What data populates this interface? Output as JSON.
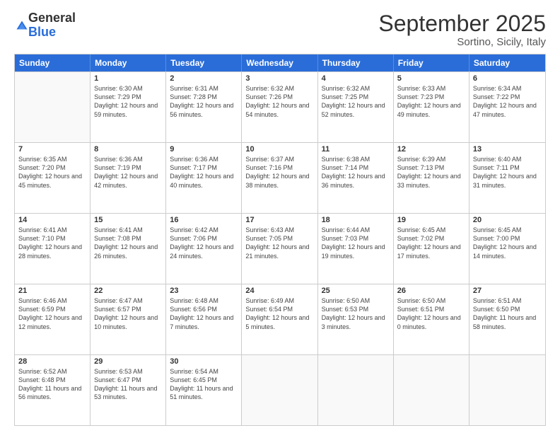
{
  "logo": {
    "general": "General",
    "blue": "Blue"
  },
  "title": "September 2025",
  "location": "Sortino, Sicily, Italy",
  "header_days": [
    "Sunday",
    "Monday",
    "Tuesday",
    "Wednesday",
    "Thursday",
    "Friday",
    "Saturday"
  ],
  "weeks": [
    [
      {
        "day": "",
        "empty": true
      },
      {
        "day": "1",
        "sunrise": "6:30 AM",
        "sunset": "7:29 PM",
        "daylight": "12 hours and 59 minutes."
      },
      {
        "day": "2",
        "sunrise": "6:31 AM",
        "sunset": "7:28 PM",
        "daylight": "12 hours and 56 minutes."
      },
      {
        "day": "3",
        "sunrise": "6:32 AM",
        "sunset": "7:26 PM",
        "daylight": "12 hours and 54 minutes."
      },
      {
        "day": "4",
        "sunrise": "6:32 AM",
        "sunset": "7:25 PM",
        "daylight": "12 hours and 52 minutes."
      },
      {
        "day": "5",
        "sunrise": "6:33 AM",
        "sunset": "7:23 PM",
        "daylight": "12 hours and 49 minutes."
      },
      {
        "day": "6",
        "sunrise": "6:34 AM",
        "sunset": "7:22 PM",
        "daylight": "12 hours and 47 minutes."
      }
    ],
    [
      {
        "day": "7",
        "sunrise": "6:35 AM",
        "sunset": "7:20 PM",
        "daylight": "12 hours and 45 minutes."
      },
      {
        "day": "8",
        "sunrise": "6:36 AM",
        "sunset": "7:19 PM",
        "daylight": "12 hours and 42 minutes."
      },
      {
        "day": "9",
        "sunrise": "6:36 AM",
        "sunset": "7:17 PM",
        "daylight": "12 hours and 40 minutes."
      },
      {
        "day": "10",
        "sunrise": "6:37 AM",
        "sunset": "7:16 PM",
        "daylight": "12 hours and 38 minutes."
      },
      {
        "day": "11",
        "sunrise": "6:38 AM",
        "sunset": "7:14 PM",
        "daylight": "12 hours and 36 minutes."
      },
      {
        "day": "12",
        "sunrise": "6:39 AM",
        "sunset": "7:13 PM",
        "daylight": "12 hours and 33 minutes."
      },
      {
        "day": "13",
        "sunrise": "6:40 AM",
        "sunset": "7:11 PM",
        "daylight": "12 hours and 31 minutes."
      }
    ],
    [
      {
        "day": "14",
        "sunrise": "6:41 AM",
        "sunset": "7:10 PM",
        "daylight": "12 hours and 28 minutes."
      },
      {
        "day": "15",
        "sunrise": "6:41 AM",
        "sunset": "7:08 PM",
        "daylight": "12 hours and 26 minutes."
      },
      {
        "day": "16",
        "sunrise": "6:42 AM",
        "sunset": "7:06 PM",
        "daylight": "12 hours and 24 minutes."
      },
      {
        "day": "17",
        "sunrise": "6:43 AM",
        "sunset": "7:05 PM",
        "daylight": "12 hours and 21 minutes."
      },
      {
        "day": "18",
        "sunrise": "6:44 AM",
        "sunset": "7:03 PM",
        "daylight": "12 hours and 19 minutes."
      },
      {
        "day": "19",
        "sunrise": "6:45 AM",
        "sunset": "7:02 PM",
        "daylight": "12 hours and 17 minutes."
      },
      {
        "day": "20",
        "sunrise": "6:45 AM",
        "sunset": "7:00 PM",
        "daylight": "12 hours and 14 minutes."
      }
    ],
    [
      {
        "day": "21",
        "sunrise": "6:46 AM",
        "sunset": "6:59 PM",
        "daylight": "12 hours and 12 minutes."
      },
      {
        "day": "22",
        "sunrise": "6:47 AM",
        "sunset": "6:57 PM",
        "daylight": "12 hours and 10 minutes."
      },
      {
        "day": "23",
        "sunrise": "6:48 AM",
        "sunset": "6:56 PM",
        "daylight": "12 hours and 7 minutes."
      },
      {
        "day": "24",
        "sunrise": "6:49 AM",
        "sunset": "6:54 PM",
        "daylight": "12 hours and 5 minutes."
      },
      {
        "day": "25",
        "sunrise": "6:50 AM",
        "sunset": "6:53 PM",
        "daylight": "12 hours and 3 minutes."
      },
      {
        "day": "26",
        "sunrise": "6:50 AM",
        "sunset": "6:51 PM",
        "daylight": "12 hours and 0 minutes."
      },
      {
        "day": "27",
        "sunrise": "6:51 AM",
        "sunset": "6:50 PM",
        "daylight": "11 hours and 58 minutes."
      }
    ],
    [
      {
        "day": "28",
        "sunrise": "6:52 AM",
        "sunset": "6:48 PM",
        "daylight": "11 hours and 56 minutes."
      },
      {
        "day": "29",
        "sunrise": "6:53 AM",
        "sunset": "6:47 PM",
        "daylight": "11 hours and 53 minutes."
      },
      {
        "day": "30",
        "sunrise": "6:54 AM",
        "sunset": "6:45 PM",
        "daylight": "11 hours and 51 minutes."
      },
      {
        "day": "",
        "empty": true
      },
      {
        "day": "",
        "empty": true
      },
      {
        "day": "",
        "empty": true
      },
      {
        "day": "",
        "empty": true
      }
    ]
  ]
}
